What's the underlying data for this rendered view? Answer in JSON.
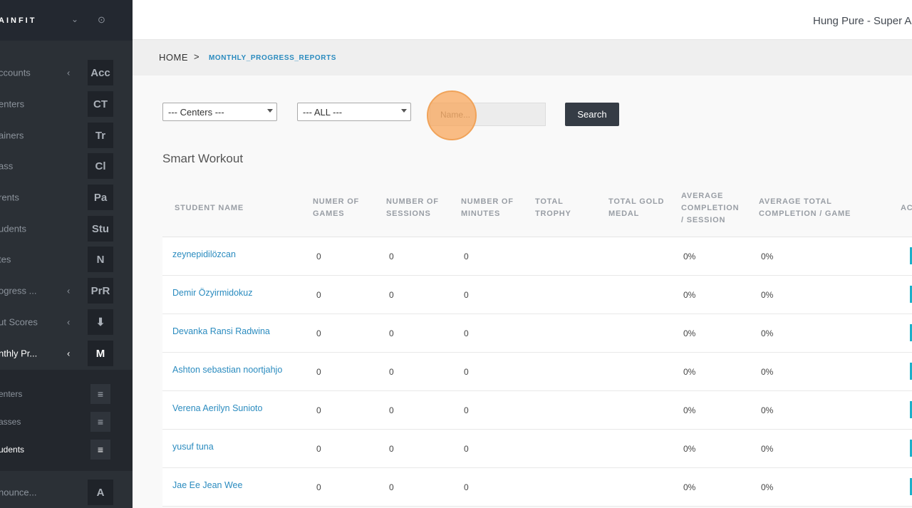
{
  "sidebar": {
    "brand": "AINFIT",
    "nav": [
      {
        "label": "ccounts",
        "abbr": "Acc",
        "chevron": true
      },
      {
        "label": "enters",
        "abbr": "CT",
        "chevron": false
      },
      {
        "label": "ainers",
        "abbr": "Tr",
        "chevron": false
      },
      {
        "label": "ass",
        "abbr": "Cl",
        "chevron": false
      },
      {
        "label": "rents",
        "abbr": "Pa",
        "chevron": false
      },
      {
        "label": "udents",
        "abbr": "Stu",
        "chevron": false
      },
      {
        "label": "tes",
        "abbr": "N",
        "chevron": false
      },
      {
        "label": "ogress ...",
        "abbr": "PrR",
        "chevron": true
      },
      {
        "label": "ut Scores",
        "abbr": "⬇",
        "chevron": true
      },
      {
        "label": "nthly Pr...",
        "abbr": "M",
        "chevron": true
      },
      {
        "label": "nounce...",
        "abbr": "A",
        "chevron": false
      }
    ],
    "sub_items": [
      {
        "label": "enters"
      },
      {
        "label": "asses"
      },
      {
        "label": "udents"
      }
    ]
  },
  "topbar": {
    "user": "Hung Pure - Super A"
  },
  "breadcrumb": {
    "home": "HOME",
    "separator": ">",
    "current": "MONTHLY_PROGRESS_REPORTS"
  },
  "filters": {
    "centers_selected": "--- Centers ---",
    "all_selected": "--- ALL ---",
    "name_placeholder": "Name...",
    "search_label": "Search"
  },
  "section_title": "Smart Workout",
  "table": {
    "headers": [
      "STUDENT NAME",
      "NUMER OF\nGAMES",
      "NUMBER OF\nSESSIONS",
      "NUMBER OF\nMINUTES",
      "TOTAL\nTROPHY",
      "TOTAL GOLD\nMEDAL",
      "AVERAGE\nCOMPLETION\n/ SESSION",
      "AVERAGE TOTAL\nCOMPLETION / GAME",
      "AC"
    ],
    "rows": [
      {
        "name": "zeynepidilözcan",
        "games": "0",
        "sessions": "0",
        "minutes": "0",
        "trophy": "",
        "gold": "",
        "avg_session": "0%",
        "avg_game": "0%"
      },
      {
        "name": "Demir Özyirmidokuz",
        "games": "0",
        "sessions": "0",
        "minutes": "0",
        "trophy": "",
        "gold": "",
        "avg_session": "0%",
        "avg_game": "0%"
      },
      {
        "name": "Devanka Ransi Radwina",
        "games": "0",
        "sessions": "0",
        "minutes": "0",
        "trophy": "",
        "gold": "",
        "avg_session": "0%",
        "avg_game": "0%"
      },
      {
        "name": "Ashton sebastian noortjahjo",
        "games": "0",
        "sessions": "0",
        "minutes": "0",
        "trophy": "",
        "gold": "",
        "avg_session": "0%",
        "avg_game": "0%"
      },
      {
        "name": "Verena Aerilyn Sunioto",
        "games": "0",
        "sessions": "0",
        "minutes": "0",
        "trophy": "",
        "gold": "",
        "avg_session": "0%",
        "avg_game": "0%"
      },
      {
        "name": "yusuf tuna",
        "games": "0",
        "sessions": "0",
        "minutes": "0",
        "trophy": "",
        "gold": "",
        "avg_session": "0%",
        "avg_game": "0%"
      },
      {
        "name": "Jae Ee Jean Wee",
        "games": "0",
        "sessions": "0",
        "minutes": "0",
        "trophy": "",
        "gold": "",
        "avg_session": "0%",
        "avg_game": "0%"
      }
    ]
  },
  "colors": {
    "accent": "#2a8bbf",
    "sidebar_bg": "#2b3036",
    "button_dark": "#353c45",
    "highlight": "#f8a356",
    "action_teal": "#1cb0c9"
  }
}
